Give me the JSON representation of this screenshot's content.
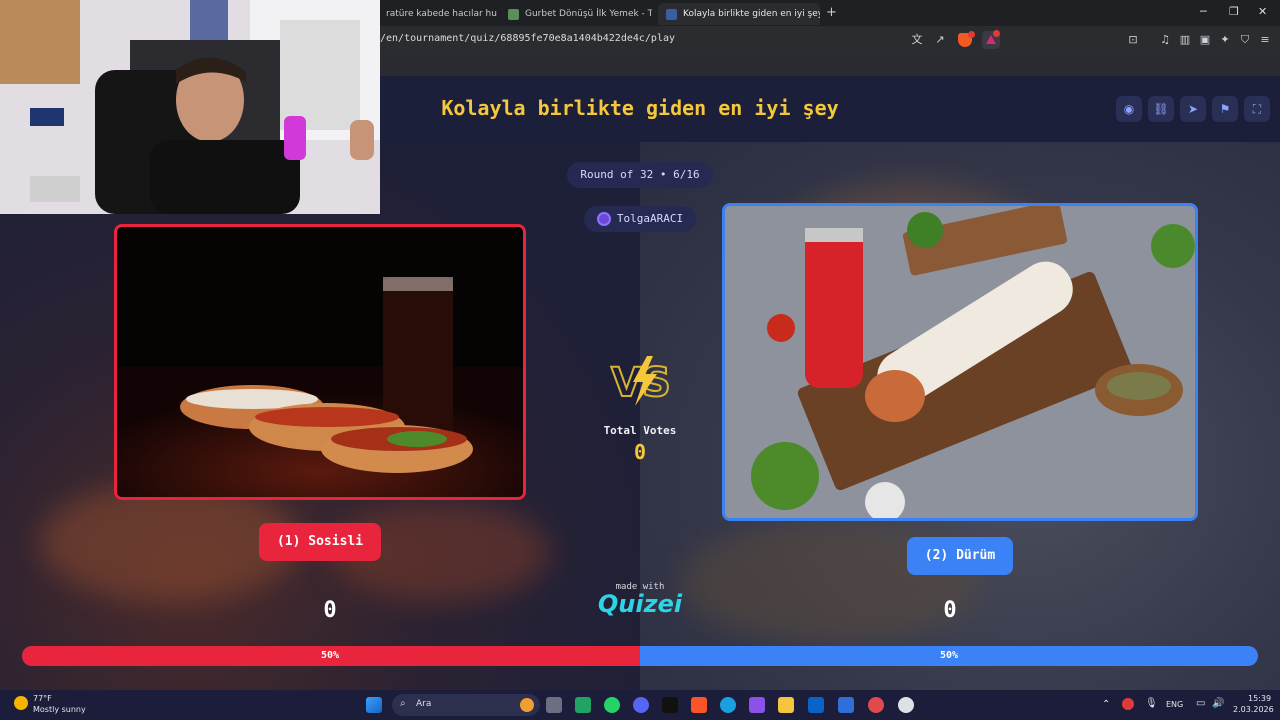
{
  "browser": {
    "tabs": [
      {
        "label": "ratüre kabede hacılar hu der"
      },
      {
        "label": "Gurbet Dönüşü İlk Yemek - Tier List,"
      },
      {
        "label": "Kolayla birlikte giden en iyi şey"
      }
    ],
    "url": "/en/tournament/quiz/68895fe70e8a1404b422de4c/play",
    "new_tab": "+",
    "win_min": "─",
    "win_max": "❐",
    "win_close": "✕"
  },
  "header": {
    "title": "Kolayla birlikte giden en iyi şey",
    "buttons": [
      "eye-icon",
      "link-icon",
      "send-icon",
      "flag-icon",
      "fullscreen-icon"
    ]
  },
  "round": {
    "text": "Round of 32 • 6/16"
  },
  "creator": {
    "name": "TolgaARACI"
  },
  "vs": {
    "total_label": "Total Votes",
    "total_value": "0"
  },
  "left": {
    "label": "(1) Sosisli",
    "votes": "0",
    "percent_label": "50%",
    "percent": 50,
    "color": "#e8253d"
  },
  "right": {
    "label": "(2) Dürüm",
    "votes": "0",
    "percent_label": "50%",
    "percent": 50,
    "color": "#3b82f6"
  },
  "footer": {
    "made_with": "made with",
    "brand": "Quizei"
  },
  "taskbar": {
    "weather_temp": "77°F",
    "weather_desc": "Mostly sunny",
    "search_placeholder": "Ara",
    "lang": "ENG",
    "time": "15:39",
    "date": "2.03.2026"
  },
  "accent": "#f5c73a"
}
